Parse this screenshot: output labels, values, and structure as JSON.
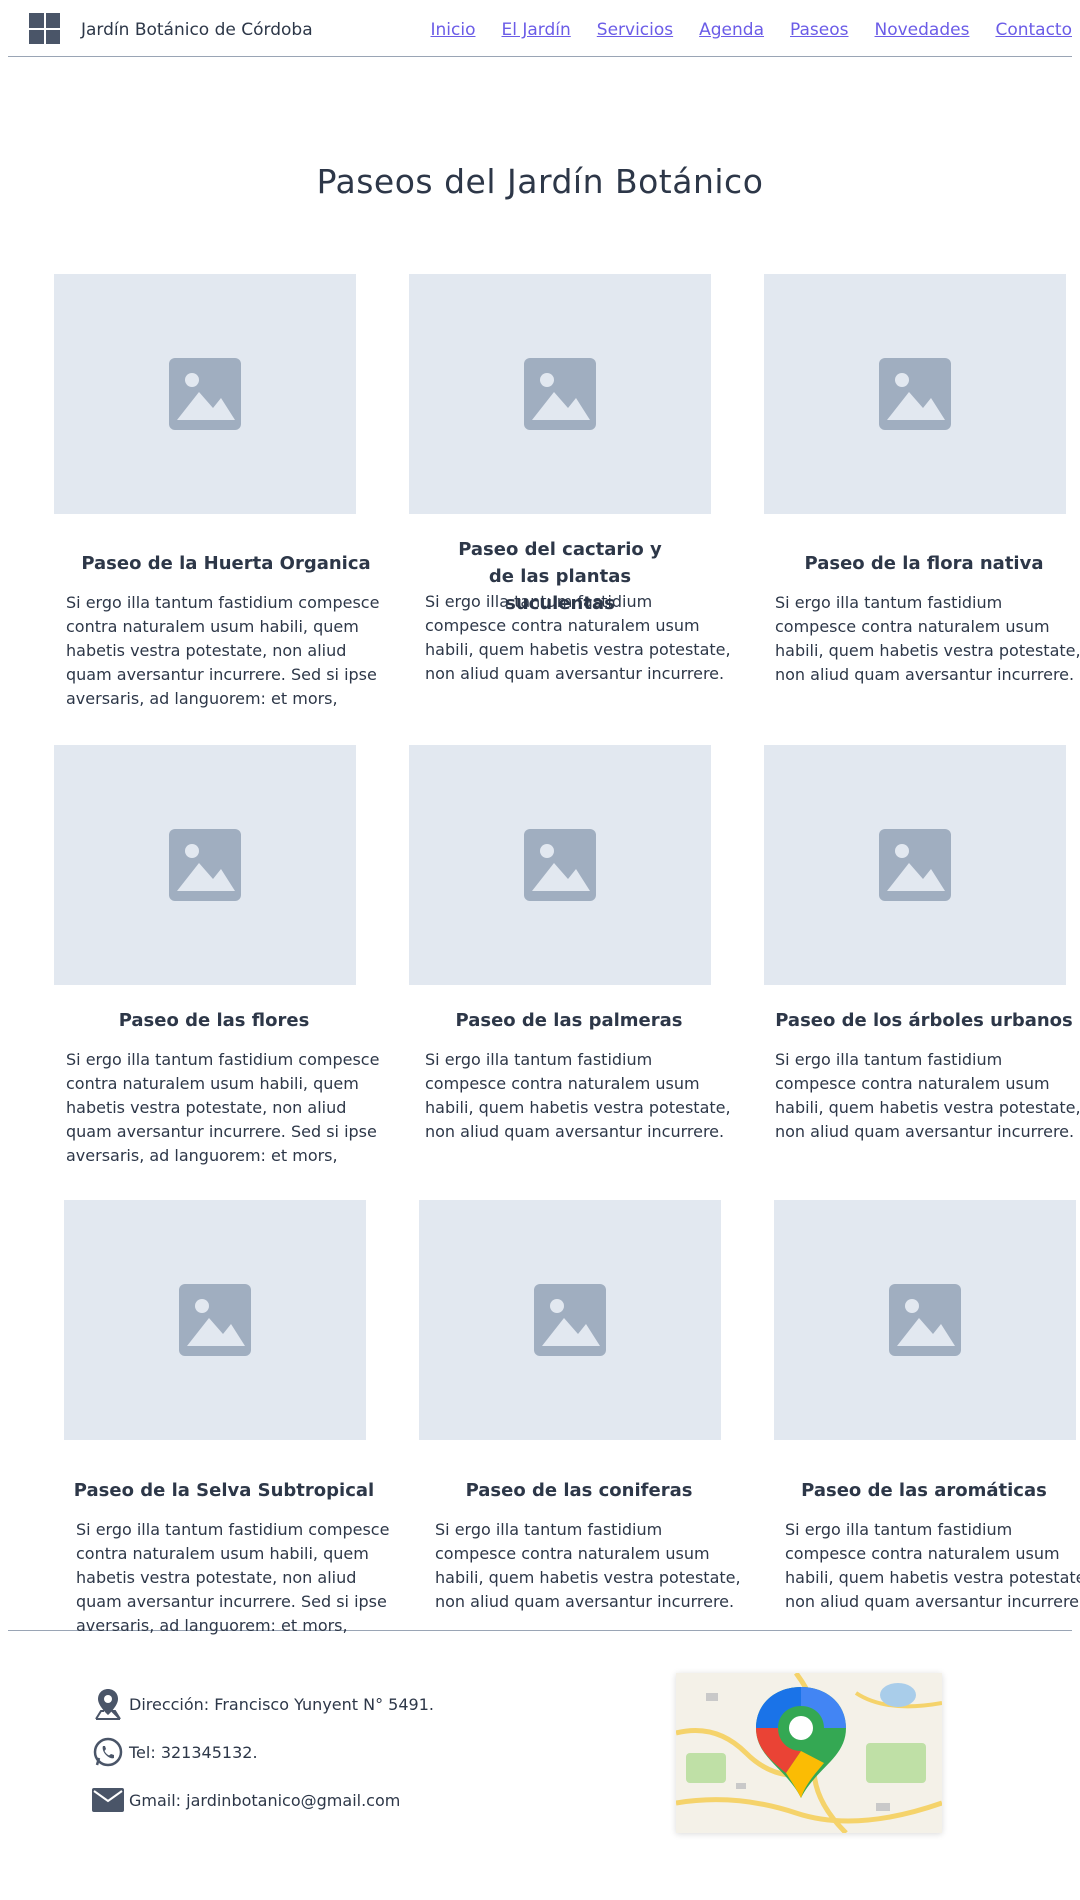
{
  "header": {
    "site_title": "Jardín Botánico de Córdoba",
    "nav": [
      "Inicio",
      "El Jardín",
      "Servicios",
      "Agenda",
      "Paseos",
      "Novedades",
      "Contacto"
    ]
  },
  "page_title": "Paseos del Jardín Botánico",
  "cards": [
    {
      "title": "Paseo de la Huerta Organica",
      "text": "Si ergo illa tantum fastidium compesce contra naturalem usum habili, quem habetis vestra potestate, non aliud quam aversantur incurrere. Sed si ipse aversaris, ad languorem: et mors,"
    },
    {
      "title": "Paseo del cactario y de las plantas suculentas",
      "text": "Si ergo illa tantum fastidium compesce contra naturalem usum habili, quem habetis vestra potestate, non aliud quam aversantur incurrere."
    },
    {
      "title": "Paseo de la flora nativa",
      "text": "Si ergo illa tantum fastidium compesce contra naturalem usum habili, quem habetis vestra potestate, non aliud quam aversantur incurrere."
    },
    {
      "title": "Paseo de las flores",
      "text": "Si ergo illa tantum fastidium compesce contra naturalem usum habili, quem habetis vestra potestate, non aliud quam aversantur incurrere. Sed si ipse aversaris, ad languorem: et mors,"
    },
    {
      "title": "Paseo de las palmeras",
      "text": "Si ergo illa tantum fastidium compesce contra naturalem usum habili, quem habetis vestra potestate, non aliud quam aversantur incurrere."
    },
    {
      "title": "Paseo de los árboles urbanos",
      "text": "Si ergo illa tantum fastidium compesce contra naturalem usum habili, quem habetis vestra potestate, non aliud quam aversantur incurrere."
    },
    {
      "title": "Paseo de la Selva Subtropical",
      "text": "Si ergo illa tantum fastidium compesce contra naturalem usum habili, quem habetis vestra potestate, non aliud quam aversantur incurrere. Sed si ipse aversaris, ad languorem: et mors,"
    },
    {
      "title": "Paseo de las coniferas",
      "text": "Si ergo illa tantum fastidium compesce contra naturalem usum habili, quem habetis vestra potestate, non aliud quam aversantur incurrere."
    },
    {
      "title": "Paseo de las aromáticas",
      "text": "Si ergo illa tantum fastidium compesce contra naturalem usum habili, quem habetis vestra potestate, non aliud quam aversantur incurrere."
    }
  ],
  "footer": {
    "address": "Dirección: Francisco Yunyent N° 5491.",
    "phone": "Tel: 321345132.",
    "email": "Gmail: jardinbotanico@gmail.com"
  },
  "icons": {
    "logo": "grid-icon",
    "placeholder": "image-placeholder-icon",
    "address": "location-pin-icon",
    "phone": "whatsapp-phone-icon",
    "email": "envelope-icon",
    "map": "google-maps-icon"
  },
  "colors": {
    "nav_link": "#6b5ce7",
    "text": "#2d3748",
    "placeholder_bg": "#e2e8f0",
    "placeholder_icon": "#a0aec0",
    "divider": "#9aa5b5"
  }
}
